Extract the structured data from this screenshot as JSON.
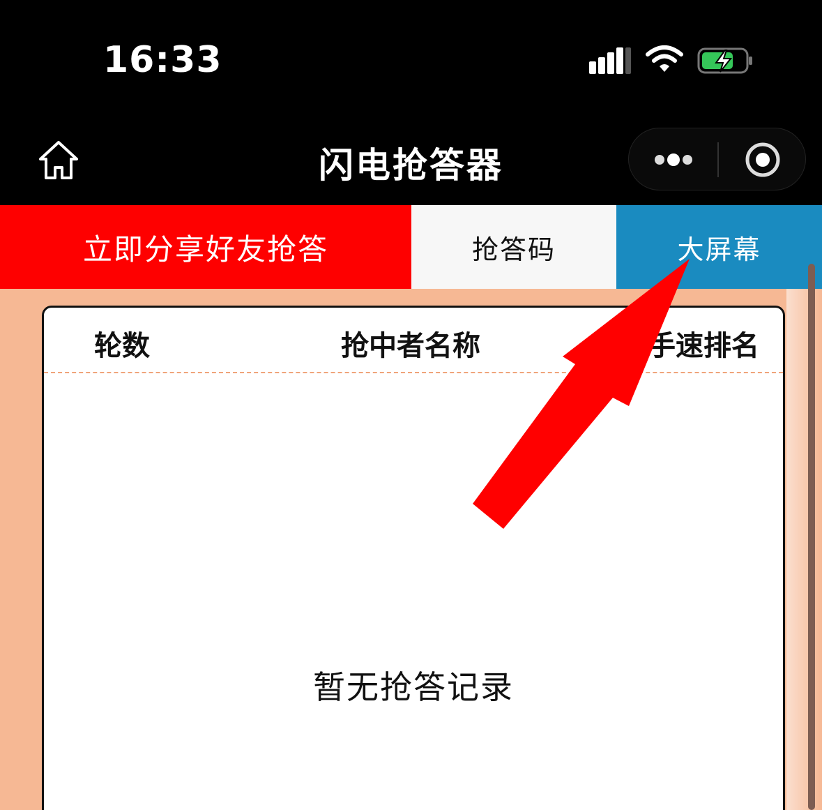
{
  "status_bar": {
    "time": "16:33"
  },
  "nav": {
    "title": "闪电抢答器"
  },
  "tabs": {
    "share_label": "立即分享好友抢答",
    "code_label": "抢答码",
    "big_screen_label": "大屏幕"
  },
  "table": {
    "col_round": "轮数",
    "col_name": "抢中者名称",
    "col_rank": "手速排名",
    "empty_text": "暂无抢答记录"
  },
  "colors": {
    "share_tab": "#fe0000",
    "big_screen_tab": "#1a8bc0",
    "background": "#f6b894",
    "arrow": "#ff0000",
    "battery": "#35c759"
  },
  "icons": {
    "home": "home-icon",
    "more": "more-dots-icon",
    "close": "target-circle-icon",
    "signal": "signal-icon",
    "wifi": "wifi-icon",
    "battery": "battery-charging-icon",
    "annotation": "red-arrow-icon"
  }
}
